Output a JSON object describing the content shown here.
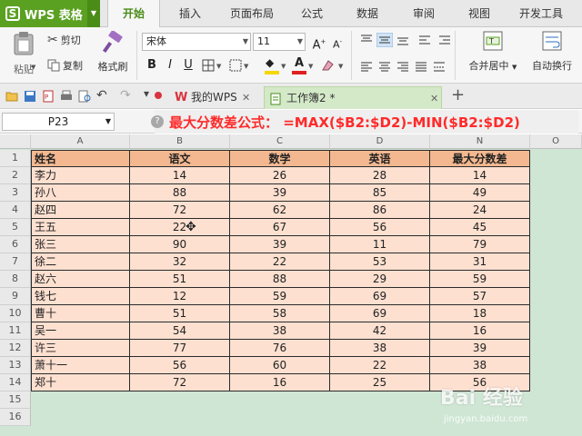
{
  "app": {
    "logo_letter": "S",
    "name": "WPS 表格"
  },
  "menu": {
    "tabs": [
      {
        "label": "开始",
        "active": true
      },
      {
        "label": "插入",
        "active": false
      },
      {
        "label": "页面布局",
        "active": false
      },
      {
        "label": "公式",
        "active": false
      },
      {
        "label": "数据",
        "active": false
      },
      {
        "label": "审阅",
        "active": false
      },
      {
        "label": "视图",
        "active": false
      },
      {
        "label": "开发工具",
        "active": false
      }
    ]
  },
  "ribbon": {
    "paste_label": "粘贴",
    "cut_label": "剪切",
    "copy_label": "复制",
    "format_painter_label": "格式刷",
    "font_name": "宋体",
    "font_size": "11",
    "merge_center_label": "合并居中",
    "wrap_text_label": "自动换行",
    "font_color": "#e02020",
    "fill_color": "#f6d600",
    "font_buttons": [
      "B",
      "I",
      "U"
    ]
  },
  "doc_tabs": [
    {
      "label": "我的WPS",
      "active": false
    },
    {
      "label": "工作簿2 *",
      "active": true
    }
  ],
  "formula_bar": {
    "cell_ref": "P23",
    "annotation": "最大分数差公式：  =MAX($B2:$D2)-MIN($B2:$D2)"
  },
  "grid": {
    "columns": [
      "A",
      "B",
      "C",
      "D",
      "N",
      "O"
    ],
    "row_numbers": [
      "1",
      "2",
      "3",
      "4",
      "5",
      "6",
      "7",
      "8",
      "9",
      "10",
      "11",
      "12",
      "13",
      "14",
      "15",
      "16"
    ],
    "header": [
      "姓名",
      "语文",
      "数学",
      "英语",
      "最大分数差"
    ],
    "rows": [
      [
        "李力",
        "14",
        "26",
        "28",
        "14"
      ],
      [
        "孙八",
        "88",
        "39",
        "85",
        "49"
      ],
      [
        "赵四",
        "72",
        "62",
        "86",
        "24"
      ],
      [
        "王五",
        "22",
        "67",
        "56",
        "45"
      ],
      [
        "张三",
        "90",
        "39",
        "11",
        "79"
      ],
      [
        "徐二",
        "32",
        "22",
        "53",
        "31"
      ],
      [
        "赵六",
        "51",
        "88",
        "29",
        "59"
      ],
      [
        "钱七",
        "12",
        "59",
        "69",
        "57"
      ],
      [
        "曹十",
        "51",
        "58",
        "69",
        "18"
      ],
      [
        "吴一",
        "54",
        "38",
        "42",
        "16"
      ],
      [
        "许三",
        "77",
        "76",
        "38",
        "39"
      ],
      [
        "萧十一",
        "56",
        "60",
        "22",
        "38"
      ],
      [
        "郑十",
        "72",
        "16",
        "25",
        "56"
      ]
    ],
    "colors": {
      "header_fill": "#f3b890",
      "body_fill": "#fde0d0",
      "background": "#cfe6d4"
    }
  },
  "watermark": {
    "brand": "Bai 经验",
    "url": "jingyan.baidu.com"
  }
}
